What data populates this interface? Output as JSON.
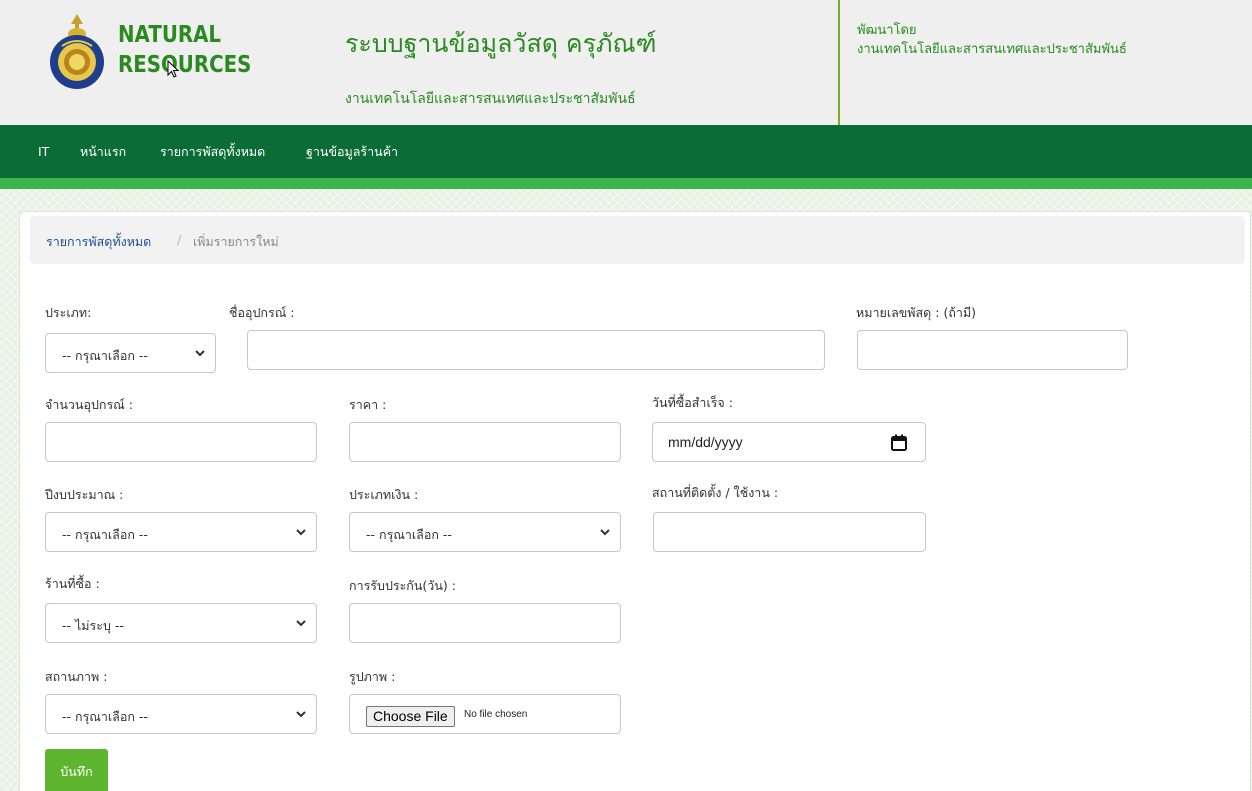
{
  "header": {
    "brand_line1": "NATURAL",
    "brand_line2": "RESOURCES",
    "seal_text": "Prince of Songkla University",
    "title": "ระบบฐานข้อมูลวัสดุ ครุภัณฑ์",
    "subtitle": "งานเทคโนโลยีและสารสนเทศและประชาสัมพันธ์",
    "developed_by_label": "พัฒนาโดย",
    "developed_by_name": "งานเทคโนโลยีและสารสนเทศและประชาสัมพันธ์"
  },
  "colors": {
    "brand_green": "#2a8a21",
    "nav_bg": "#0b6c35",
    "nav_strip": "#39b54a",
    "save_button": "#5db530",
    "link": "#1e4f8f"
  },
  "nav": {
    "items": [
      {
        "label": "IT"
      },
      {
        "label": "หน้าแรก"
      },
      {
        "label": "รายการพัสดุทั้งหมด"
      },
      {
        "label": "ฐานข้อมูลร้านค้า"
      }
    ]
  },
  "breadcrumb": {
    "parent": "รายการพัสดุทั้งหมด",
    "separator": "/",
    "current": "เพิ่มรายการใหม่"
  },
  "form": {
    "type_label": "ประเภท:",
    "type_value": "-- กรุณาเลือก --",
    "name_label": "ชื่ออุปกรณ์ :",
    "name_value": "",
    "number_label": "หมายเลขพัสดุ : (ถ้ามี)",
    "number_value": "",
    "quantity_label": "จำนวนอุปกรณ์ :",
    "quantity_value": "",
    "price_label": "ราคา :",
    "price_value": "",
    "purchase_date_label": "วันที่ซื้อสำเร็จ :",
    "purchase_date_placeholder": "mm/dd/yyyy",
    "fiscal_year_label": "ปีงบประมาณ :",
    "fiscal_year_value": "-- กรุณาเลือก --",
    "money_type_label": "ประเภทเงิน :",
    "money_type_value": "-- กรุณาเลือก --",
    "location_label": "สถานที่ติดตั้ง / ใช้งาน :",
    "location_value": "",
    "shop_label": "ร้านที่ซื้อ :",
    "shop_value": "-- ไม่ระบุ --",
    "warranty_label": "การรับประกัน(วัน) :",
    "warranty_value": "",
    "status_label": "สถานภาพ :",
    "status_value": "-- กรุณาเลือก --",
    "image_label": "รูปภาพ :",
    "file_button": "Choose File",
    "file_status": "No file chosen",
    "save_label": "บันทึก"
  }
}
